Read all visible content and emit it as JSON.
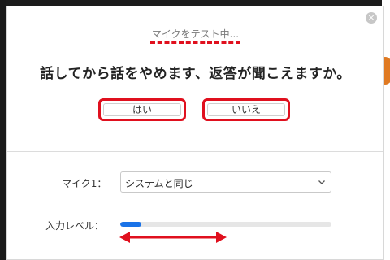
{
  "dialog": {
    "status_text": "マイクをテスト中...",
    "question": "話してから話をやめます、返答が聞こえますか。",
    "yes_label": "はい",
    "no_label": "いいえ",
    "close_icon": "close-icon"
  },
  "settings": {
    "mic_label": "マイク1：",
    "mic_selected": "システムと同じ",
    "level_label": "入力レベル："
  },
  "input_level": {
    "fraction": 0.1
  },
  "colors": {
    "accent": "#1a73e8",
    "annotation": "#e0101e",
    "background_accent": "#e07a22"
  }
}
